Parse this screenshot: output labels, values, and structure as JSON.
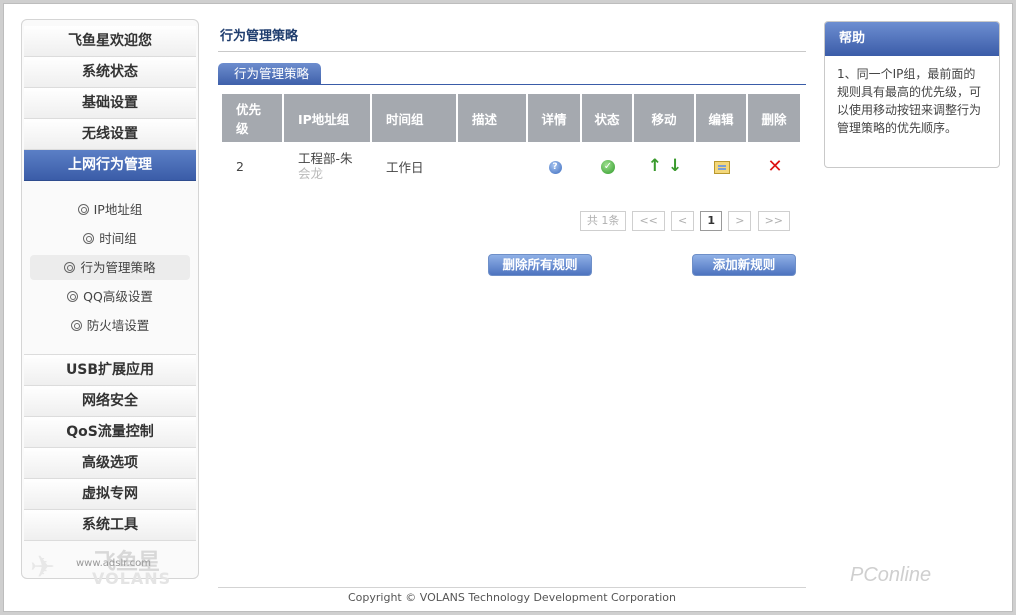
{
  "sidebar": {
    "items_top": [
      "飞鱼星欢迎您",
      "系统状态",
      "基础设置",
      "无线设置",
      "上网行为管理"
    ],
    "active_index": 4,
    "subitems": [
      "IP地址组",
      "时间组",
      "行为管理策略",
      "QQ高级设置",
      "防火墙设置"
    ],
    "active_sub_index": 2,
    "items_bottom": [
      "USB扩展应用",
      "网络安全",
      "QoS流量控制",
      "高级选项",
      "虚拟专网",
      "系统工具"
    ]
  },
  "logo": {
    "brand": "飞鱼星",
    "url": "www.adslr.com",
    "sub": "VOLANS"
  },
  "main": {
    "title": "行为管理策略",
    "tab": "行为管理策略",
    "columns": [
      "优先级",
      "IP地址组",
      "时间组",
      "描述",
      "详情",
      "状态",
      "移动",
      "编辑",
      "删除"
    ],
    "rows": [
      {
        "priority": "2",
        "ip_group": "工程部-朱",
        "ip_group_cont": "会龙",
        "time_group": "工作日",
        "desc": ""
      }
    ],
    "pager": {
      "total": "共 1条",
      "first": "<<",
      "prev": "<",
      "current": "1",
      "next": ">",
      "last": ">>"
    },
    "delete_all": "删除所有规则",
    "add_new": "添加新规则"
  },
  "help": {
    "title": "帮助",
    "text": "1、同一个IP组，最前面的规则具有最高的优先级，可以使用移动按钮来调整行为管理策略的优先顺序。"
  },
  "footer": "Copyright © VOLANS Technology Development Corporation",
  "watermark": "PConline"
}
